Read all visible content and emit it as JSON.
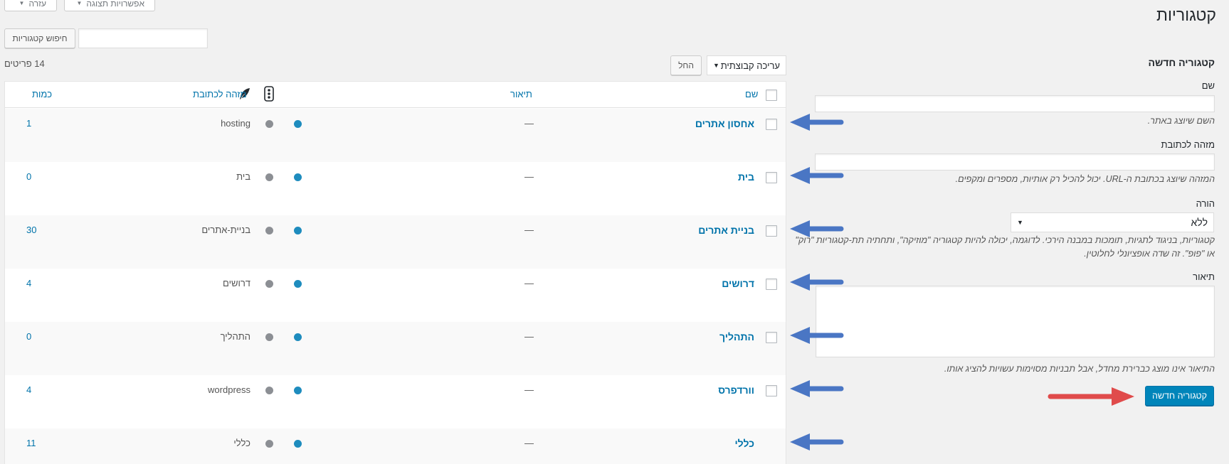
{
  "page_title": "קטגוריות",
  "screen_options": {
    "options_label": "אפשרויות תצוגה",
    "help_label": "עזרה"
  },
  "search": {
    "button_label": "חיפוש קטגוריות",
    "value": ""
  },
  "bulk": {
    "selected": "עריכה קבוצתית",
    "apply_label": "החל",
    "items_count": "14 פריטים"
  },
  "table": {
    "headers": {
      "name": "שם",
      "description": "תיאור",
      "slug": "מזהה לכתובת",
      "count": "כמות"
    },
    "rows": [
      {
        "name": "אחסון אתרים",
        "description": "—",
        "slug": "hosting",
        "count": "1"
      },
      {
        "name": "בית",
        "description": "—",
        "slug": "בית",
        "count": "0"
      },
      {
        "name": "בניית אתרים",
        "description": "—",
        "slug": "בניית-אתרים",
        "count": "30"
      },
      {
        "name": "דרושים",
        "description": "—",
        "slug": "דרושים",
        "count": "4"
      },
      {
        "name": "התהליך",
        "description": "—",
        "slug": "התהליך",
        "count": "0"
      },
      {
        "name": "וורדפרס",
        "description": "—",
        "slug": "wordpress",
        "count": "4"
      },
      {
        "name": "כללי",
        "description": "—",
        "slug": "כללי",
        "count": "11"
      }
    ]
  },
  "form": {
    "title": "קטגוריה חדשה",
    "name_label": "שם",
    "name_help": "השם שיוצג באתר.",
    "slug_label": "מזהה לכתובת",
    "slug_help": "המזהה שיוצג בכתובת ה-URL. יכול להכיל רק אותיות, מספרים ומקפים.",
    "parent_label": "הורה",
    "parent_value": "ללא",
    "parent_help_1": "קטגוריות, בניגוד לתגיות, תומכות במבנה הירכי. לדוגמה, יכולה להיות קטגוריה \"מוזיקה\", ותחתיה תת-קטגוריות \"רוק\"",
    "parent_help_2": "או \"פופ\". זה שדה אופציונלי לחלוטין.",
    "description_label": "תיאור",
    "description_help": "התיאור אינו מוצג כברירת מחדל, אבל תבניות מסוימות עשויות להציג אותו.",
    "submit_label": "קטגוריה חדשה"
  },
  "colors": {
    "link": "#0073aa",
    "primary_button": "#0085ba",
    "arrow_blue": "#4a76c4",
    "arrow_red": "#e04b4b"
  },
  "icons": [
    "caret-down-icon",
    "feather-icon",
    "traffic-light-icon",
    "checkbox-icon",
    "arrow-left-icon"
  ]
}
